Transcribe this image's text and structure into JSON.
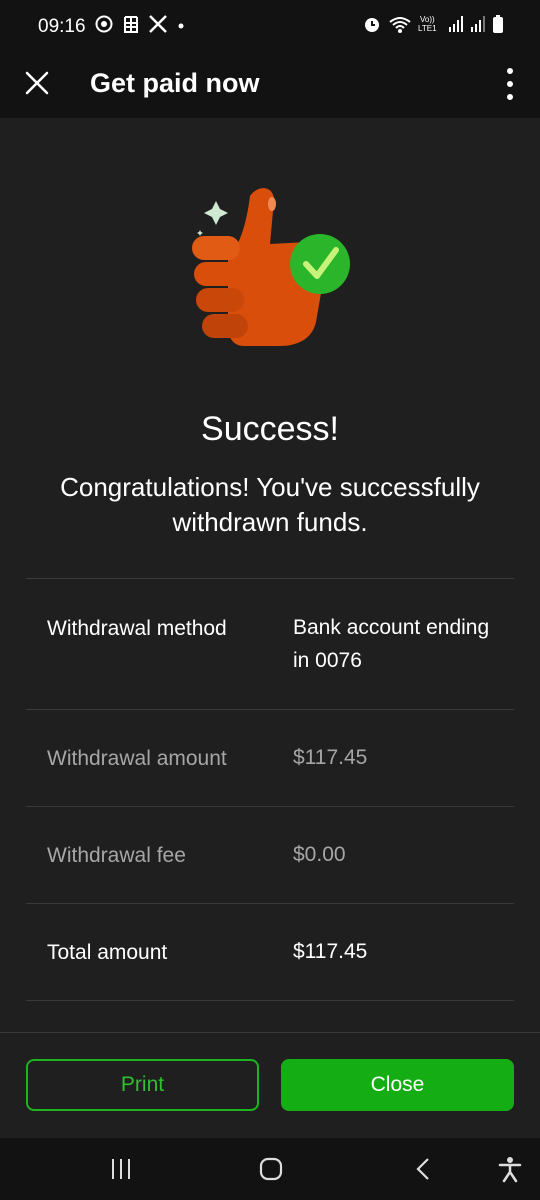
{
  "status_bar": {
    "time": "09:16",
    "left_icons": [
      "sync-icon",
      "calendar-icon",
      "x-logo-icon",
      "dot-icon"
    ],
    "right_icons": [
      "alarm-icon",
      "wifi-icon",
      "volte-icon",
      "signal-icon",
      "signal-icon-2",
      "battery-icon"
    ],
    "volte_label": "Vo))\nLTE1"
  },
  "app_bar": {
    "title": "Get paid now",
    "close_icon": "close-icon",
    "menu_icon": "more-vert-icon"
  },
  "hero": {
    "icon": "thumbs-up-check-icon",
    "title": "Success!",
    "message": "Congratulations! You've successfully withdrawn funds."
  },
  "details": [
    {
      "label": "Withdrawal method",
      "value": "Bank account ending in 0076",
      "emphasis": true
    },
    {
      "label": "Withdrawal amount",
      "value": "$117.45",
      "emphasis": false
    },
    {
      "label": "Withdrawal fee",
      "value": "$0.00",
      "emphasis": false
    },
    {
      "label": "Total amount",
      "value": "$117.45",
      "emphasis": true
    }
  ],
  "actions": {
    "print_label": "Print",
    "close_label": "Close"
  },
  "colors": {
    "accent_green": "#14ad14",
    "thumb_orange": "#e0520e",
    "background": "#1f1f1f"
  },
  "nav_bar": {
    "icons": [
      "recent-apps-icon",
      "home-icon",
      "back-icon",
      "accessibility-icon"
    ]
  }
}
